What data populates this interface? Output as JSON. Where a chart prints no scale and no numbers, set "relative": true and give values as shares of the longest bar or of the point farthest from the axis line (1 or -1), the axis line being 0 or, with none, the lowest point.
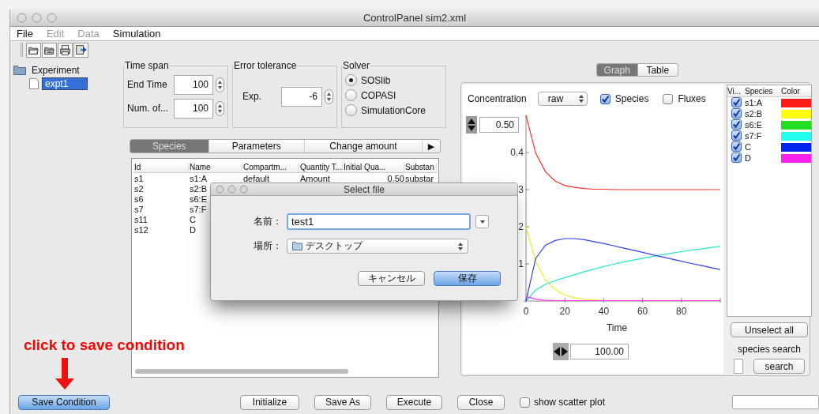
{
  "window": {
    "title": "ControlPanel sim2.xml"
  },
  "menu": [
    {
      "label": "File",
      "disabled": false
    },
    {
      "label": "Edit",
      "disabled": true
    },
    {
      "label": "Data",
      "disabled": true
    },
    {
      "label": "Simulation",
      "disabled": false
    }
  ],
  "tree": [
    {
      "label": "Experiment",
      "selected": false,
      "children": [
        {
          "label": "expt1",
          "selected": true
        }
      ]
    }
  ],
  "time_span": {
    "title": "Time span",
    "fields": [
      {
        "label": "End Time",
        "value": "100"
      },
      {
        "label": "Num. of...",
        "value": "100"
      }
    ]
  },
  "error_tolerance": {
    "title": "Error tolerance",
    "label": "Exp.",
    "value": "-6"
  },
  "solver": {
    "title": "Solver",
    "options": [
      {
        "label": "SOSlib",
        "selected": true
      },
      {
        "label": "COPASI",
        "selected": false
      },
      {
        "label": "SimulationCore",
        "selected": false
      }
    ]
  },
  "tabs": [
    {
      "label": "Species",
      "selected": true
    },
    {
      "label": "Parameters",
      "selected": false
    },
    {
      "label": "Change amount",
      "selected": false
    }
  ],
  "tabs_more": "▶",
  "species_table": {
    "columns": [
      "Id",
      "Name",
      "Compartm...",
      "Quantity T...",
      "Initial Qua...",
      "Substan"
    ],
    "rows": [
      [
        "s1",
        "s1:A",
        "default",
        "Amount",
        "0.50",
        "substar"
      ],
      [
        "s2",
        "s2:B"
      ],
      [
        "s6",
        "s6:E"
      ],
      [
        "s7",
        "s7:F"
      ],
      [
        "s11",
        "C"
      ],
      [
        "s12",
        "D"
      ]
    ]
  },
  "graph_tabs": [
    {
      "label": "Graph",
      "selected": true
    },
    {
      "label": "Table",
      "selected": false
    }
  ],
  "graph": {
    "quantity_label": "Concentration",
    "mode": "raw",
    "species_checkbox": {
      "label": "Species",
      "checked": true
    },
    "fluxes_checkbox": {
      "label": "Fluxes",
      "checked": false
    },
    "y_max": "0.50",
    "x_max": "100.00",
    "y_tick_labels": [
      "0.4",
      "3",
      "2",
      "1"
    ],
    "chart_data": {
      "type": "line",
      "relative": true,
      "xlabel": "Time",
      "x": [
        0,
        5,
        10,
        15,
        20,
        25,
        30,
        35,
        40,
        45,
        50,
        55,
        60,
        65,
        70,
        75,
        80,
        85,
        90,
        95,
        100
      ],
      "xlim": [
        0,
        100
      ],
      "xticks": [
        0,
        20,
        40,
        60,
        80
      ],
      "series": [
        {
          "color": "#ff3030",
          "values": [
            1,
            0.796,
            0.696,
            0.646,
            0.622,
            0.612,
            0.606,
            0.602,
            0.602,
            0.6,
            0.6,
            0.6,
            0.6,
            0.6,
            0.6,
            0.6,
            0.6,
            0.6,
            0.6,
            0.6,
            0.6
          ]
        },
        {
          "color": "#eeee20",
          "values": [
            0.4,
            0.214,
            0.114,
            0.062,
            0.032,
            0.018,
            0.01,
            0.006,
            0.002,
            null,
            null,
            null,
            null,
            null,
            null,
            null,
            null,
            null,
            null,
            null,
            null
          ]
        },
        {
          "color": "#22e8c8",
          "values": [
            0,
            0.06,
            0.09,
            0.11,
            0.126,
            0.142,
            0.158,
            0.172,
            0.186,
            0.198,
            0.21,
            0.22,
            0.23,
            0.24,
            0.25,
            0.258,
            0.266,
            0.274,
            0.28,
            0.288,
            0.294
          ]
        },
        {
          "color": "#3340ee",
          "values": [
            0,
            0.23,
            0.3,
            0.326,
            0.336,
            0.336,
            0.33,
            0.32,
            0.31,
            0.298,
            0.286,
            0.274,
            0.262,
            0.25,
            0.238,
            0.226,
            0.214,
            0.202,
            0.192,
            0.18,
            0.17
          ]
        },
        {
          "color": "#ff30ee",
          "values": [
            0.024,
            0.01,
            0.004,
            0.002,
            0.002,
            0.002,
            0.002,
            0.002,
            0.002,
            0.002,
            0.002,
            0.002,
            0.002,
            0.002,
            0.002,
            0.002,
            0.002,
            0.002,
            0.002,
            0.002,
            0.002
          ]
        }
      ]
    }
  },
  "legend": {
    "columns": [
      "Vi...",
      "Species",
      "Color"
    ],
    "rows": [
      {
        "visible": true,
        "species": "s1:A",
        "color": "#ff1a1a"
      },
      {
        "visible": true,
        "species": "s2:B",
        "color": "#ffff00"
      },
      {
        "visible": true,
        "species": "s6:E",
        "color": "#22dd22"
      },
      {
        "visible": true,
        "species": "s7:F",
        "color": "#22ffee"
      },
      {
        "visible": true,
        "species": "C",
        "color": "#0022ee"
      },
      {
        "visible": true,
        "species": "D",
        "color": "#ff22ee"
      }
    ]
  },
  "unselect_all": "Unselect all",
  "species_search": {
    "label": "species search",
    "button": "search"
  },
  "footer": {
    "buttons": [
      {
        "label": "Save Condition",
        "kind": "primary"
      },
      {
        "label": "Initialize",
        "kind": "normal"
      },
      {
        "label": "Save As",
        "kind": "normal"
      },
      {
        "label": "Execute",
        "kind": "normal"
      },
      {
        "label": "Close",
        "kind": "normal"
      }
    ],
    "scatter": {
      "label": "show scatter plot",
      "checked": false
    }
  },
  "annotation": "click to save condition",
  "dialog": {
    "title": "Select file",
    "name_label": "名前：",
    "name_value": "test1",
    "location_label": "場所：",
    "location_value": "デスクトップ",
    "buttons": [
      {
        "label": "キャンセル",
        "kind": "normal"
      },
      {
        "label": "保存",
        "kind": "primary"
      }
    ]
  }
}
